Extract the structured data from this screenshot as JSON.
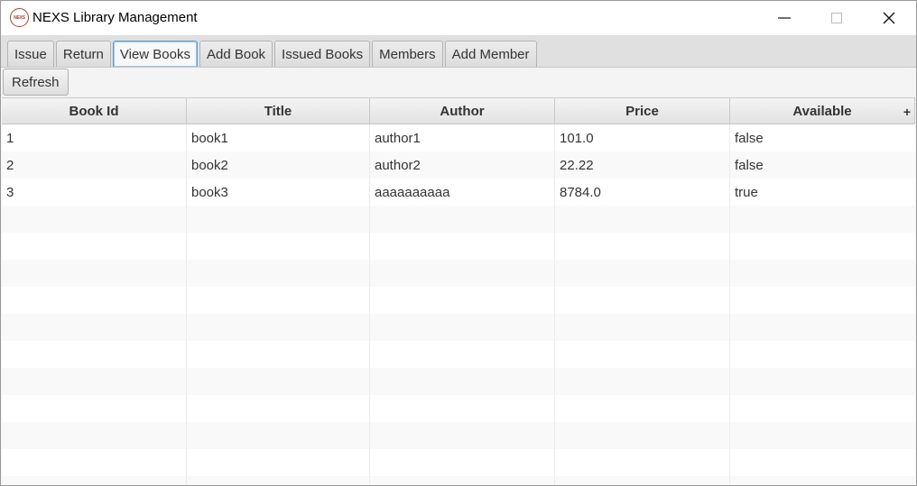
{
  "window": {
    "title": "NEXS Library Management",
    "logo_text": "NEXS"
  },
  "tabs": [
    {
      "label": "Issue",
      "active": false
    },
    {
      "label": "Return",
      "active": false
    },
    {
      "label": "View Books",
      "active": true
    },
    {
      "label": "Add Book",
      "active": false
    },
    {
      "label": "Issued Books",
      "active": false
    },
    {
      "label": "Members",
      "active": false
    },
    {
      "label": "Add Member",
      "active": false
    }
  ],
  "toolbar": {
    "refresh_label": "Refresh"
  },
  "table": {
    "columns": [
      "Book Id",
      "Title",
      "Author",
      "Price",
      "Available"
    ],
    "column_menu_symbol": "+",
    "rows": [
      [
        "1",
        "book1",
        "author1",
        "101.0",
        "false"
      ],
      [
        "2",
        "book2",
        "author2",
        "22.22",
        "false"
      ],
      [
        "3",
        "book3",
        "aaaaaaaaaa",
        "8784.0",
        "true"
      ]
    ]
  },
  "colors": {
    "active_tab_border": "#5a9fd4",
    "logo": "#c0392b"
  },
  "icons": {
    "minimize": "minimize-icon",
    "maximize": "maximize-icon",
    "close": "close-icon"
  }
}
